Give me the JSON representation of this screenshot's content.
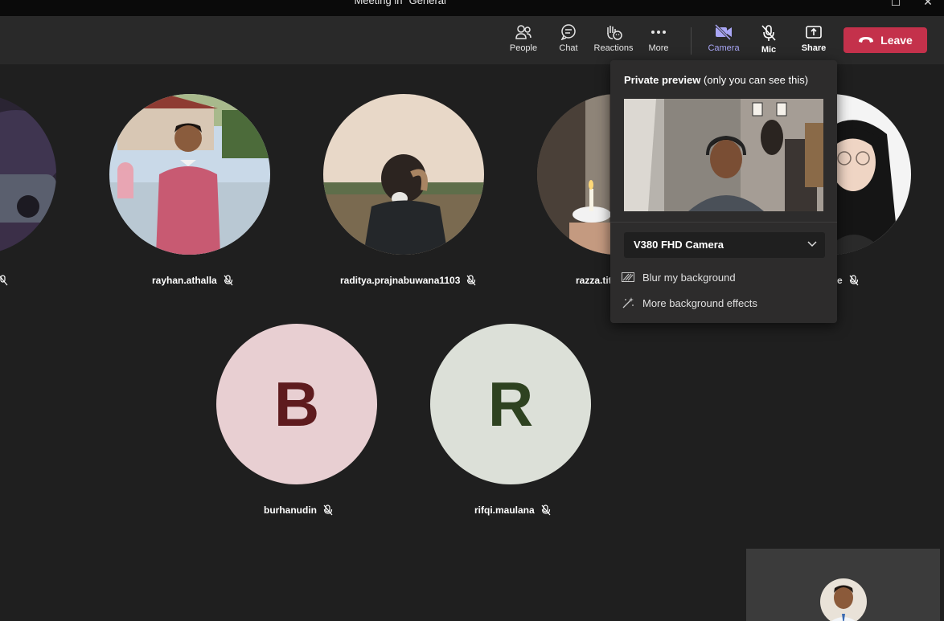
{
  "window": {
    "title": "Meeting in \"General\""
  },
  "toolbar": {
    "people": "People",
    "chat": "Chat",
    "reactions": "Reactions",
    "more": "More",
    "camera": "Camera",
    "mic": "Mic",
    "share": "Share",
    "leave": "Leave"
  },
  "participants": [
    {
      "name": "rayhan.athalla"
    },
    {
      "name": "raditya.prajnabuwana1103"
    },
    {
      "name": "razza.titi"
    },
    {
      "name": "e"
    },
    {
      "name": "burhanudin",
      "initial": "B"
    },
    {
      "name": "rifqi.maulana",
      "initial": "R"
    }
  ],
  "camera_panel": {
    "heading_bold": "Private preview",
    "heading_rest": "(only you can see this)",
    "device": "V380 FHD Camera",
    "blur": "Blur my background",
    "effects": "More background effects"
  },
  "colors": {
    "accent": "#a9a6f5",
    "leave": "#c4314b",
    "b_bg": "#e8cfd2",
    "b_fg": "#5e1b1e",
    "r_bg": "#dce0d8",
    "r_fg": "#2e4220"
  }
}
